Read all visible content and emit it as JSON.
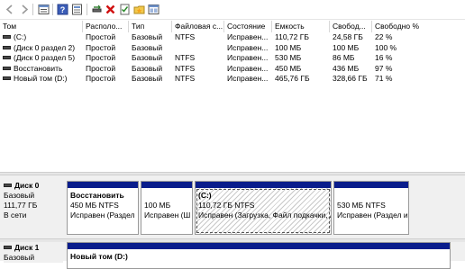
{
  "toolbar": {
    "buttons": [
      {
        "icon": "back-icon"
      },
      {
        "icon": "forward-icon"
      },
      {
        "icon": "list-view-icon"
      },
      {
        "icon": "help-icon"
      },
      {
        "icon": "properties-icon"
      },
      {
        "icon": "connect-disk-icon"
      },
      {
        "icon": "delete-icon"
      },
      {
        "icon": "checklist-icon"
      },
      {
        "icon": "folder-star-icon"
      },
      {
        "icon": "layout-icon"
      }
    ]
  },
  "volume_list": {
    "columns": [
      "Том",
      "Располо...",
      "Тип",
      "Файловая с...",
      "Состояние",
      "Емкость",
      "Свобод...",
      "Свободно %"
    ],
    "rows": [
      [
        "(C:)",
        "Простой",
        "Базовый",
        "NTFS",
        "Исправен...",
        "110,72 ГБ",
        "24,58 ГБ",
        "22 %"
      ],
      [
        "(Диск 0 раздел 2)",
        "Простой",
        "Базовый",
        "",
        "Исправен...",
        "100 МБ",
        "100 МБ",
        "100 %"
      ],
      [
        "(Диск 0 раздел 5)",
        "Простой",
        "Базовый",
        "NTFS",
        "Исправен...",
        "530 МБ",
        "86 МБ",
        "16 %"
      ],
      [
        "Восстановить",
        "Простой",
        "Базовый",
        "NTFS",
        "Исправен...",
        "450 МБ",
        "436 МБ",
        "97 %"
      ],
      [
        "Новый том (D:)",
        "Простой",
        "Базовый",
        "NTFS",
        "Исправен...",
        "465,76 ГБ",
        "328,66 ГБ",
        "71 %"
      ]
    ]
  },
  "disks": [
    {
      "title": "Диск 0",
      "type": "Базовый",
      "size": "111,77 ГБ",
      "status": "В сети",
      "partitions": [
        {
          "name": "Восстановить",
          "size": "450 МБ NTFS",
          "state": "Исправен (Раздел"
        },
        {
          "name": "",
          "size": "100 МБ",
          "state": "Исправен (Ш"
        },
        {
          "name": "(C:)",
          "size": "110,72 ГБ NTFS",
          "state": "Исправен (Загрузка, Файл подкачки, А"
        },
        {
          "name": "",
          "size": "530 МБ NTFS",
          "state": "Исправен (Раздел и"
        }
      ]
    },
    {
      "title": "Диск 1",
      "type": "Базовый",
      "partitions": [
        {
          "name": "Новый том (D:)"
        }
      ]
    }
  ],
  "colors": {
    "partition_bar": "#0a1d8c",
    "disk_area_bg": "#f0f0f0"
  }
}
